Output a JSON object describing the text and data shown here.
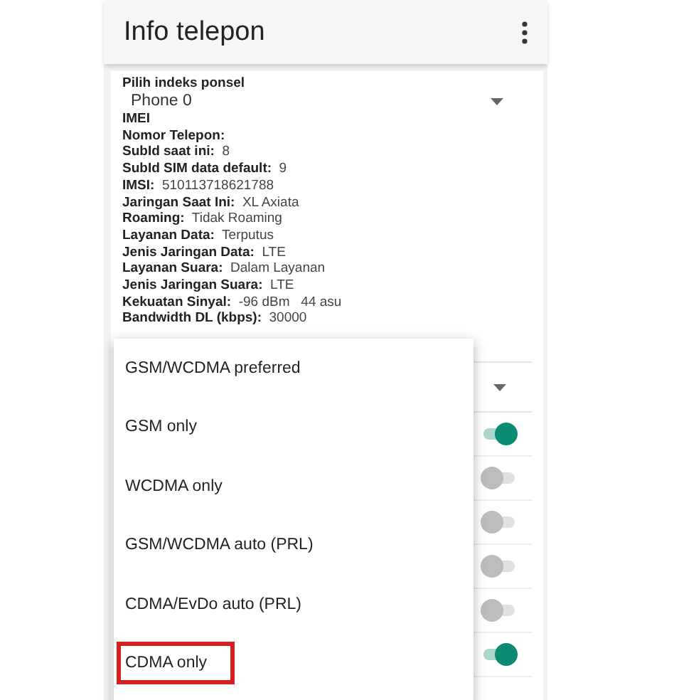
{
  "app_bar": {
    "title": "Info telepon"
  },
  "phone_index": {
    "label": "Pilih indeks ponsel",
    "value": "Phone 0"
  },
  "info": [
    {
      "label": "IMEI"
    },
    {
      "label": "Nomor Telepon:"
    },
    {
      "label": "SubId saat ini:",
      "value": "8"
    },
    {
      "label": "SubId SIM data default:",
      "value": "9"
    },
    {
      "label": "IMSI:",
      "value": "510113718621788"
    },
    {
      "label": "Jaringan Saat Ini:",
      "value": "XL Axiata"
    },
    {
      "label": "Roaming:",
      "value": "Tidak Roaming"
    },
    {
      "label": "Layanan Data:",
      "value": "Terputus"
    },
    {
      "label": "Jenis Jaringan Data:",
      "value": "LTE"
    },
    {
      "label": "Layanan Suara:",
      "value": "Dalam Layanan"
    },
    {
      "label": "Jenis Jaringan Suara:",
      "value": "LTE"
    },
    {
      "label": "Kekuatan Sinyal:",
      "value": "-96 dBm   44 asu"
    },
    {
      "label": "Bandwidth DL (kbps):",
      "value": "30000"
    }
  ],
  "switches": [
    {
      "on": true
    },
    {
      "on": false
    },
    {
      "on": false
    },
    {
      "on": false
    },
    {
      "on": false
    },
    {
      "on": true
    }
  ],
  "network_menu": [
    {
      "label": "GSM/WCDMA preferred",
      "highlighted": false
    },
    {
      "label": "GSM only",
      "highlighted": false
    },
    {
      "label": "WCDMA only",
      "highlighted": false
    },
    {
      "label": "GSM/WCDMA auto (PRL)",
      "highlighted": false
    },
    {
      "label": "CDMA/EvDo auto (PRL)",
      "highlighted": false
    },
    {
      "label": "CDMA only",
      "highlighted": true
    }
  ]
}
